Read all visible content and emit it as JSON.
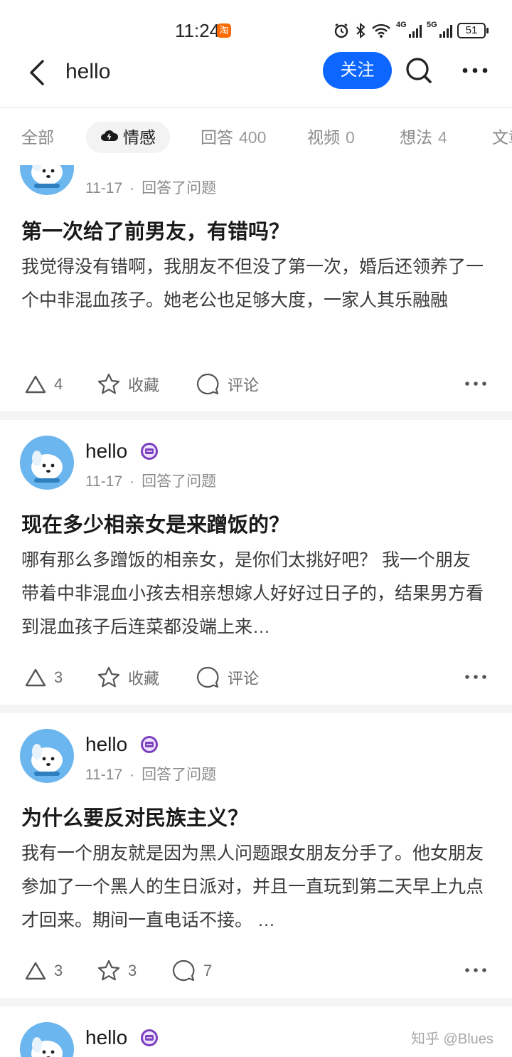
{
  "status_bar": {
    "time": "11:24",
    "taobao_badge": "淘",
    "net1": "4G",
    "net2": "5G",
    "battery": "51"
  },
  "header": {
    "title": "hello",
    "follow_label": "关注"
  },
  "colors": {
    "accent": "#0c66ff",
    "avatar_bg": "#6bb6ee",
    "badge_purple": "#7b3fbf"
  },
  "tabs": [
    {
      "label": "全部",
      "count": ""
    },
    {
      "label": "情感",
      "count": ""
    },
    {
      "label": "回答",
      "count": "400"
    },
    {
      "label": "视频",
      "count": "0"
    },
    {
      "label": "想法",
      "count": "4"
    },
    {
      "label": "文章",
      "count": ""
    }
  ],
  "feed": [
    {
      "author": "hello",
      "date": "11-17",
      "action": "回答了问题",
      "title": "第一次给了前男友，有错吗？",
      "excerpt": "我觉得没有错啊，我朋友不但没了第一次，婚后还领养了一个中非混血孩子。她老公也足够大度，一家人其乐融融",
      "likes": "4",
      "collect": "收藏",
      "comment": "评论"
    },
    {
      "author": "hello",
      "date": "11-17",
      "action": "回答了问题",
      "title": "现在多少相亲女是来蹭饭的？",
      "excerpt": "哪有那么多蹭饭的相亲女，是你们太挑好吧？ 我一个朋友带着中非混血小孩去相亲想嫁人好好过日子的，结果男方看到混血孩子后连菜都没端上来…",
      "likes": "3",
      "collect": "收藏",
      "comment": "评论"
    },
    {
      "author": "hello",
      "date": "11-17",
      "action": "回答了问题",
      "title": "为什么要反对民族主义？",
      "excerpt": "我有一个朋友就是因为黑人问题跟女朋友分手了。他女朋友参加了一个黑人的生日派对，并且一直玩到第二天早上九点才回来。期间一直电话不接。 …",
      "likes": "3",
      "collect": "3",
      "comment": "7"
    },
    {
      "author": "hello"
    }
  ],
  "watermark": "知乎 @Blues"
}
